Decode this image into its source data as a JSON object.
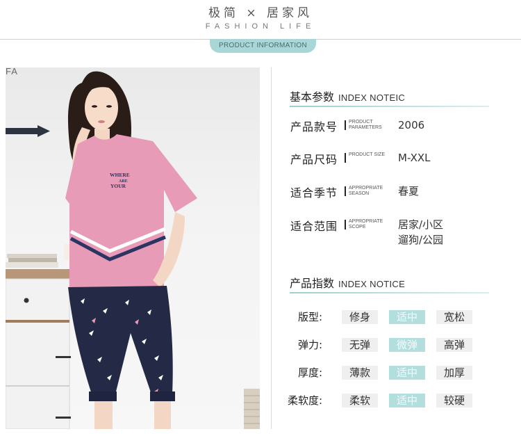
{
  "header": {
    "brand_title": "极简 × 居家风",
    "brand_sub": "FASHION LIFE",
    "pill_label": "PRODUCT INFORMATION"
  },
  "photo": {
    "wall_text": "FA",
    "shirt_text": [
      "WHERE",
      "ARE",
      "YOUR"
    ],
    "colors": {
      "shirt": "#e79bb6",
      "pants": "#242a45",
      "stripe": "#2c3463"
    }
  },
  "basic": {
    "title_zh": "基本参数",
    "title_en": "INDEX NOTEIC",
    "rows": [
      {
        "zh": "产品款号",
        "en": "PRODUCT PARAMETERS",
        "value": "2006"
      },
      {
        "zh": "产品尺码",
        "en": "PRODUCT SIZE",
        "value": "M-XXL"
      },
      {
        "zh": "适合季节",
        "en": "APPROPRIATE SEASON",
        "value": "春夏"
      },
      {
        "zh": "适合范围",
        "en": "APPROPRIATE SCOPE",
        "value": "居家/小区\n遛狗/公园"
      }
    ]
  },
  "index": {
    "title_zh": "产品指数",
    "title_en": "INDEX NOTICE",
    "rows": [
      {
        "label": "版型:",
        "options": [
          "修身",
          "适中",
          "宽松"
        ],
        "selected": 1
      },
      {
        "label": "弹力:",
        "options": [
          "无弹",
          "微弹",
          "高弹"
        ],
        "selected": 1
      },
      {
        "label": "厚度:",
        "options": [
          "薄款",
          "适中",
          "加厚"
        ],
        "selected": 1
      },
      {
        "label": "柔软度:",
        "options": [
          "柔软",
          "适中",
          "较硬"
        ],
        "selected": 1
      }
    ]
  },
  "colors": {
    "accent": "#a9d6d6",
    "selected": "#b2dede",
    "unselected": "#efefef"
  }
}
